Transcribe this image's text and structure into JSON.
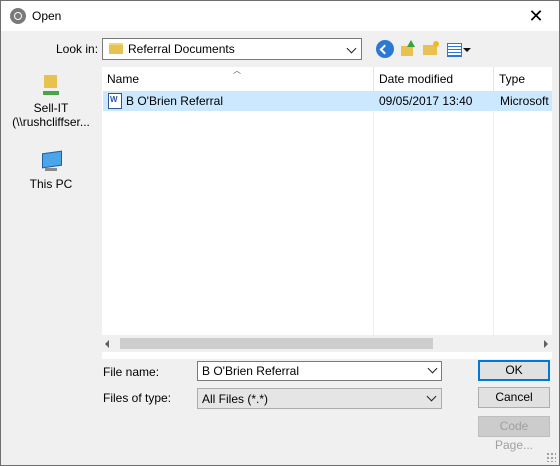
{
  "window": {
    "title": "Open"
  },
  "lookin": {
    "label": "Look in:",
    "value": "Referral Documents"
  },
  "places": [
    {
      "label_line1": "Sell-IT",
      "label_line2": "(\\\\rushcliffser..."
    },
    {
      "label": "This PC"
    }
  ],
  "columns": {
    "name": "Name",
    "date": "Date modified",
    "type": "Type"
  },
  "files": [
    {
      "name": "B O'Brien Referral",
      "date": "09/05/2017 13:40",
      "type": "Microsoft"
    }
  ],
  "form": {
    "filename_label": "File name:",
    "filename_value": "B O'Brien Referral",
    "filetype_label": "Files of type:",
    "filetype_value": "All Files (*.*)"
  },
  "buttons": {
    "ok": "OK",
    "cancel": "Cancel",
    "codepage": "Code Page..."
  },
  "colors": {
    "selection": "#cce8ff",
    "focus": "#0078d7"
  },
  "icons": [
    "app-icon",
    "close-icon",
    "folder-icon",
    "back-icon",
    "up-folder-icon",
    "new-folder-icon",
    "view-menu-icon",
    "network-drive-icon",
    "computer-icon",
    "word-document-icon"
  ]
}
